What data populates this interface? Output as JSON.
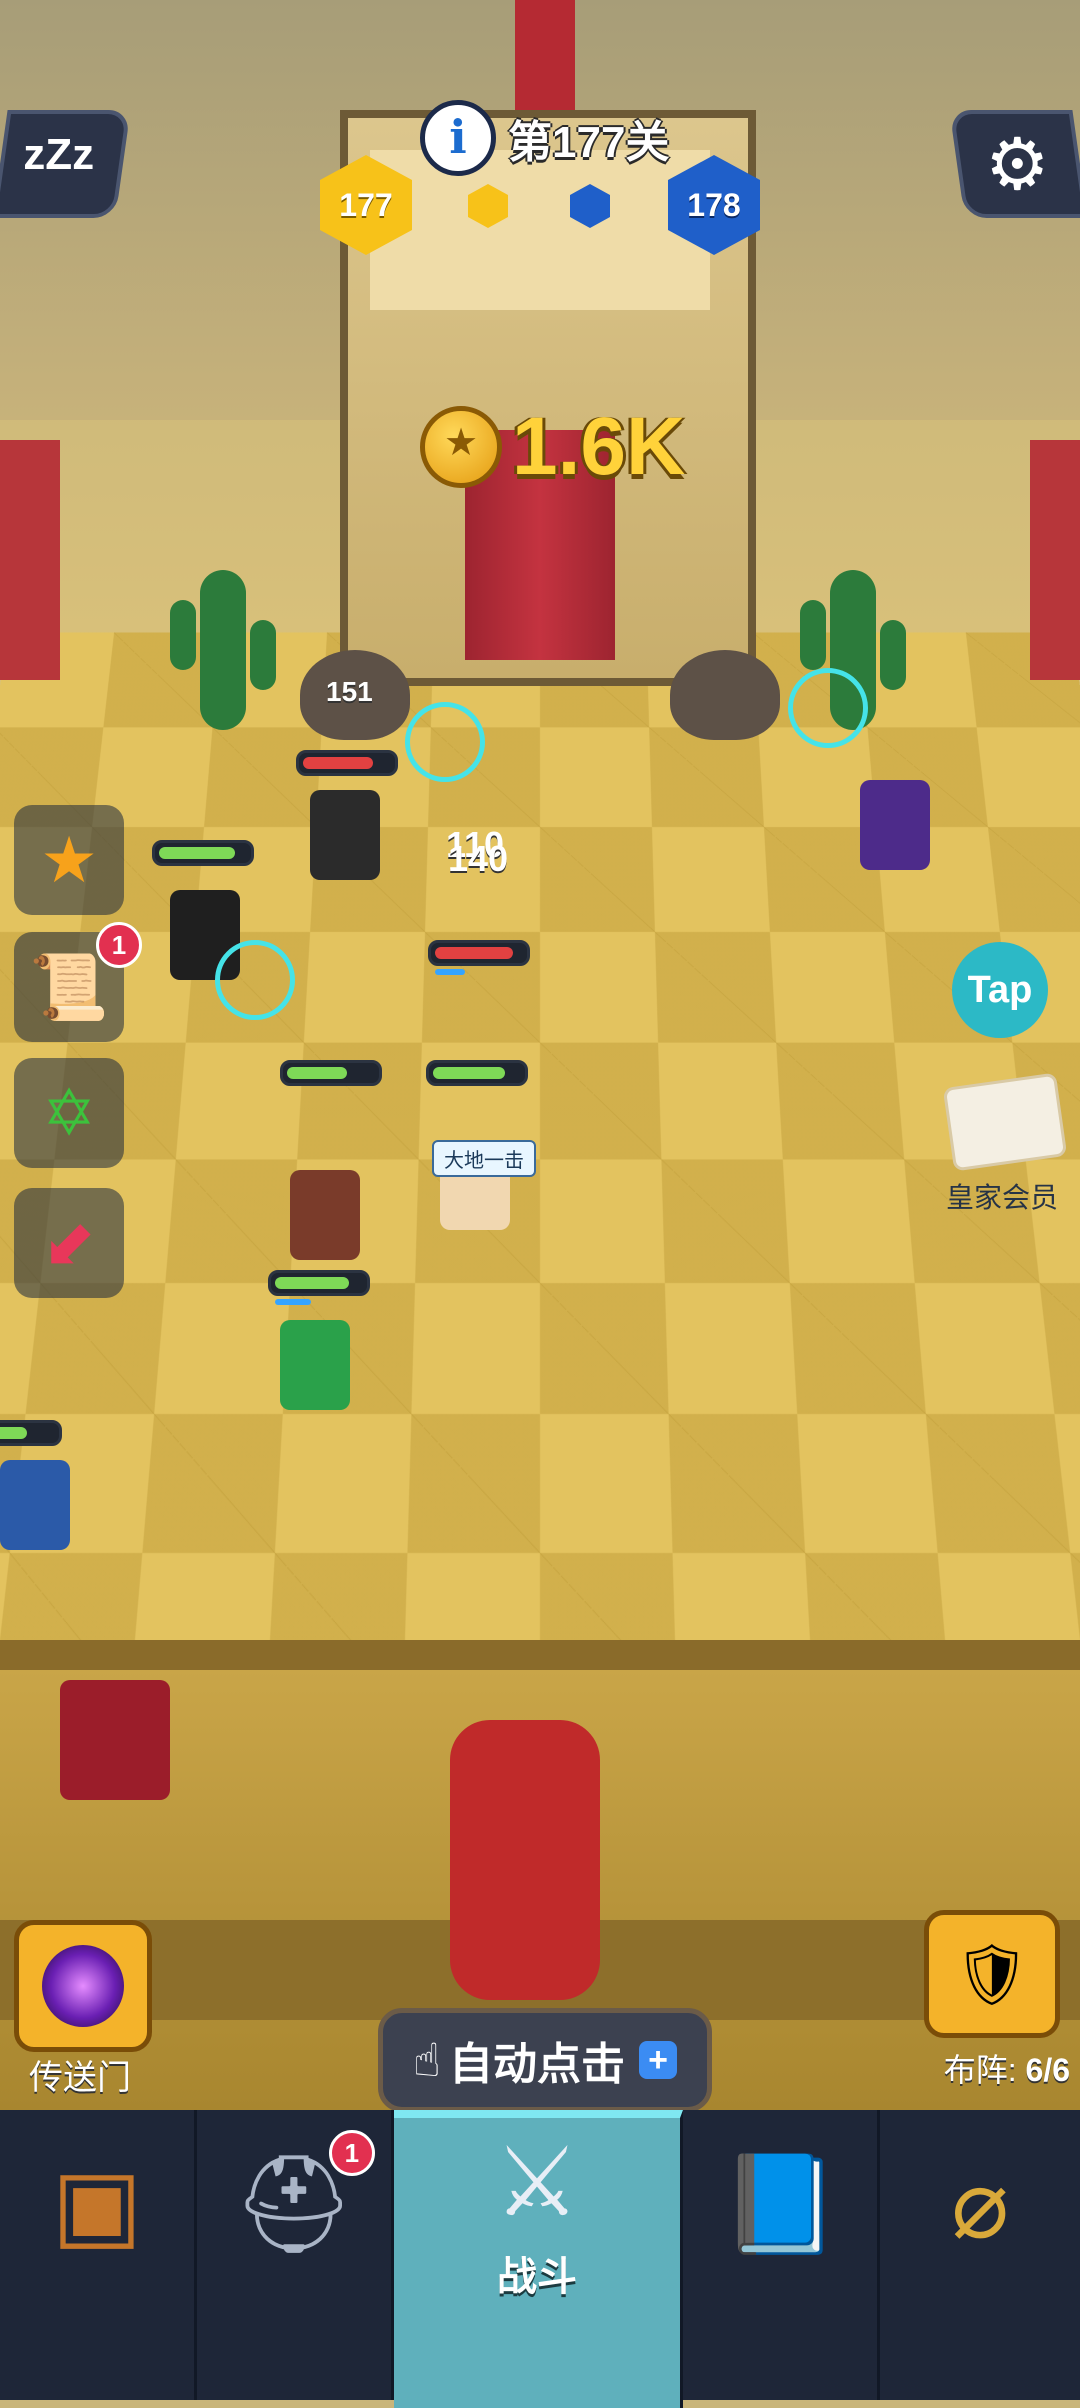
{
  "hud": {
    "sleep_label": "zZz",
    "level_label": "第177关",
    "team_left_level": "177",
    "team_right_level": "178",
    "coins": "1.6K"
  },
  "battle": {
    "damage_numbers": [
      "151",
      "110",
      "140"
    ],
    "skill_label": "大地一击"
  },
  "side_menu": {
    "quest_badge": "1"
  },
  "right_menu": {
    "tap_label": "Tap",
    "vip_label": "皇家会员"
  },
  "actions": {
    "portal_label": "传送门",
    "auto_click_label": "自动点击",
    "lineup_label": "布阵:",
    "lineup_value": "6/6"
  },
  "bottom_nav": {
    "hero_badge": "1",
    "battle_label": "战斗"
  },
  "colors": {
    "accent_teal": "#5fb0bc",
    "coin_gold": "#ffd23a",
    "hp_green": "#7ed957",
    "hp_red": "#e24141",
    "badge_red": "#e23050",
    "nav_bg": "#1e2638"
  },
  "icons": [
    "sleep-icon",
    "gear-icon",
    "info-icon",
    "coin-icon",
    "trophy-icon",
    "scroll-icon",
    "hexagram-icon",
    "arrow-icon",
    "portal-icon",
    "hand-tap-icon",
    "plus-icon",
    "chest-icon",
    "viking-helmet-icon",
    "crossed-swords-icon",
    "spellbook-icon",
    "amulet-icon"
  ]
}
